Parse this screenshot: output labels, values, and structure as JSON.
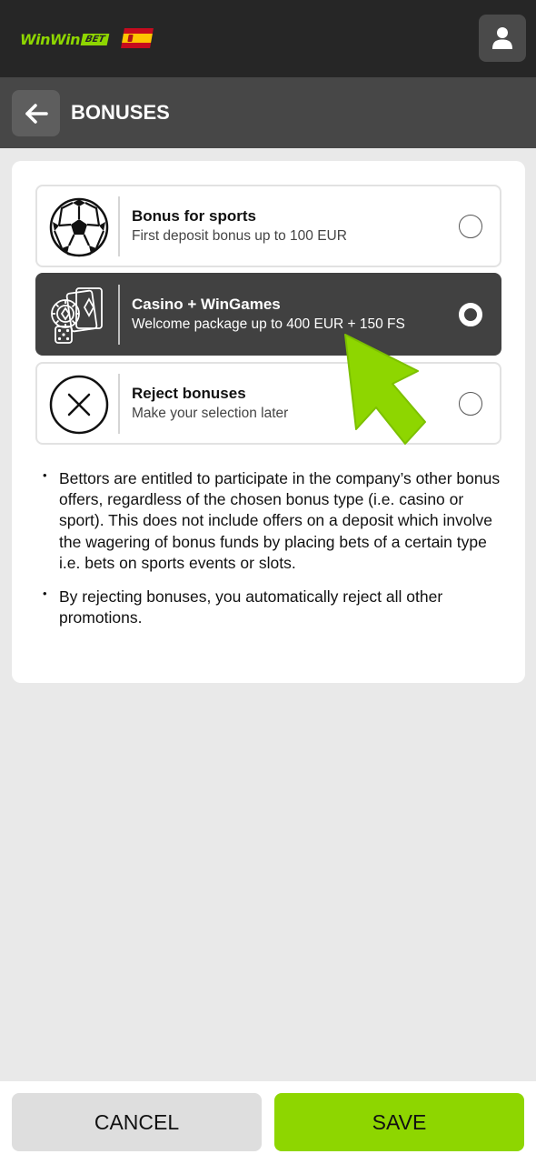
{
  "brand": {
    "logo_text": "WinWin",
    "logo_badge": "BET",
    "flag": "spain-flag",
    "accent_color": "#8ed600"
  },
  "header": {
    "title": "BONUSES",
    "back_icon": "arrow-left-icon",
    "profile_icon": "user-icon"
  },
  "bonus_options": [
    {
      "icon": "soccer-ball-icon",
      "title": "Bonus for sports",
      "subtitle": "First deposit bonus up to 100 EUR",
      "selected": false
    },
    {
      "icon": "casino-chip-cards-dice-icon",
      "title": "Casino + WinGames",
      "subtitle": "Welcome package up to 400 EUR + 150 FS",
      "selected": true
    },
    {
      "icon": "close-circle-icon",
      "title": "Reject bonuses",
      "subtitle": "Make your selection later",
      "selected": false
    }
  ],
  "notes": [
    "Bettors are entitled to participate in the company’s other bonus offers, regardless of the chosen bonus type (i.e. casino or sport). This does not include offers on a deposit which involve the wagering of bonus funds by placing bets of a certain type i.e. bets on sports events or slots.",
    "By rejecting bonuses, you automatically reject all other promotions."
  ],
  "footer": {
    "cancel_label": "CANCEL",
    "save_label": "SAVE"
  }
}
